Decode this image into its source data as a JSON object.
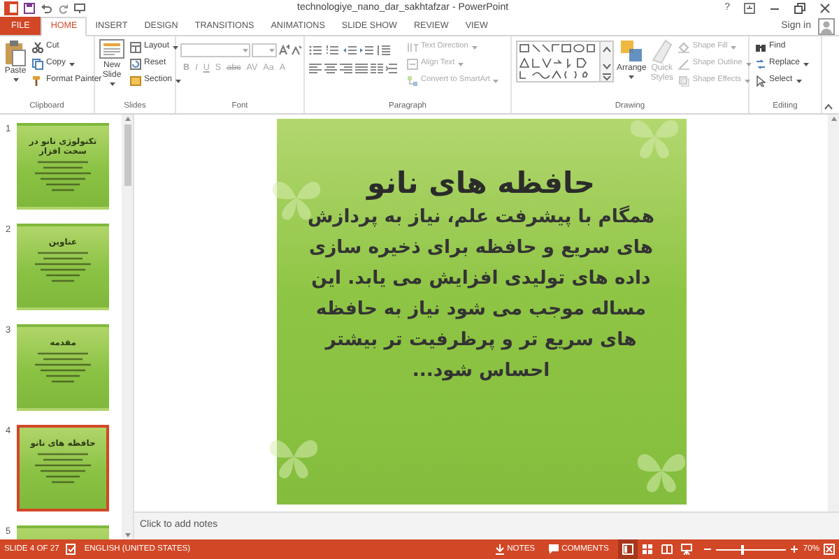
{
  "window": {
    "title": "technologiye_nano_dar_sakhtafzar - PowerPoint",
    "help": "?"
  },
  "account": {
    "label": "Sign in"
  },
  "tabs": [
    {
      "label": "FILE",
      "kind": "file",
      "selected": false
    },
    {
      "label": "HOME",
      "kind": "tab",
      "selected": true
    },
    {
      "label": "INSERT",
      "kind": "tab",
      "selected": false
    },
    {
      "label": "DESIGN",
      "kind": "tab",
      "selected": false
    },
    {
      "label": "TRANSITIONS",
      "kind": "tab",
      "selected": false
    },
    {
      "label": "ANIMATIONS",
      "kind": "tab",
      "selected": false
    },
    {
      "label": "SLIDE SHOW",
      "kind": "tab",
      "selected": false
    },
    {
      "label": "REVIEW",
      "kind": "tab",
      "selected": false
    },
    {
      "label": "VIEW",
      "kind": "tab",
      "selected": false
    }
  ],
  "ribbon": {
    "groups": [
      {
        "kind": "clipboard",
        "label": "Clipboard",
        "large": [
          {
            "label": "Paste",
            "disabled": false
          }
        ],
        "items": [
          {
            "label": "Cut",
            "disabled": false
          },
          {
            "label": "Copy",
            "disabled": false
          },
          {
            "label": "Format Painter",
            "disabled": false
          }
        ]
      },
      {
        "kind": "slides",
        "label": "Slides",
        "large": [
          {
            "label": "New Slide",
            "disabled": false
          }
        ],
        "items": [
          {
            "label": "Layout",
            "disabled": false
          },
          {
            "label": "Reset",
            "disabled": false
          },
          {
            "label": "Section",
            "disabled": false
          }
        ]
      },
      {
        "kind": "font",
        "label": "Font",
        "disabled": true,
        "buttons": [
          "B",
          "I",
          "U",
          "S",
          "abc",
          "AV",
          "Aa",
          "A"
        ]
      },
      {
        "kind": "paragraph",
        "label": "Paragraph",
        "items": [
          {
            "label": "Text Direction",
            "disabled": true
          },
          {
            "label": "Align Text",
            "disabled": true
          },
          {
            "label": "Convert to SmartArt",
            "disabled": true
          }
        ]
      },
      {
        "kind": "drawing",
        "label": "Drawing",
        "large": [
          {
            "label": "Arrange",
            "disabled": false
          },
          {
            "label": "Quick Styles",
            "disabled": true
          }
        ],
        "items": [
          {
            "label": "Shape Fill",
            "disabled": true
          },
          {
            "label": "Shape Outline",
            "disabled": true
          },
          {
            "label": "Shape Effects",
            "disabled": true
          }
        ]
      },
      {
        "kind": "editing",
        "label": "Editing",
        "items": [
          {
            "label": "Find",
            "disabled": false
          },
          {
            "label": "Replace",
            "disabled": false
          },
          {
            "label": "Select",
            "disabled": false
          }
        ]
      }
    ]
  },
  "slides": [
    {
      "number": "1",
      "title": "تکنولوژی نانو در سخت افزار",
      "selected": false
    },
    {
      "number": "2",
      "title": "عناوین",
      "selected": false
    },
    {
      "number": "3",
      "title": "مقدمه",
      "selected": false
    },
    {
      "number": "4",
      "title": "حافظه های نانو",
      "selected": true
    },
    {
      "number": "5",
      "selected": false
    }
  ],
  "current_slide": {
    "title": "حافظه های نانو",
    "body": "همگام با پیشرفت علم، نیاز به پردازش های سریع و حافظه برای ذخیره سازی داده های تولیدی افزایش می یابد. این مساله موجب می شود نیاز به حافظه های سریع تر و پرظرفیت تر بیشتر احساس شود..."
  },
  "notes": {
    "placeholder": "Click to add notes"
  },
  "status_bar": {
    "slide": "SLIDE 4 OF 27",
    "language": "ENGLISH (UNITED STATES)",
    "notes": "NOTES",
    "comments": "COMMENTS",
    "views": [
      {
        "kind": "normal",
        "selected": true
      },
      {
        "kind": "sorter",
        "selected": false
      },
      {
        "kind": "reading",
        "selected": false
      },
      {
        "kind": "slideshow",
        "selected": false
      }
    ],
    "zoom": {
      "level": 0.37,
      "reading": "70%"
    }
  }
}
